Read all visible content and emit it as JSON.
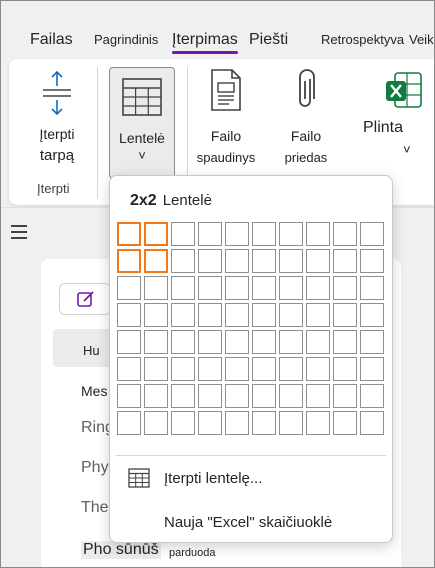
{
  "tabs": [
    {
      "label": "Failas"
    },
    {
      "label": "Pagrindinis"
    },
    {
      "label": "Įterpimas"
    },
    {
      "label": "Piešti"
    },
    {
      "label": "Retrospektyva"
    },
    {
      "label": "Veiks"
    }
  ],
  "ribbon": {
    "insert_space": {
      "line1": "Įterpti",
      "line2": "tarpą"
    },
    "group_label": "Įterpti",
    "table": {
      "label": "Lentelė",
      "chevron": "˅"
    },
    "file_printout": {
      "line1": "Failo",
      "line2": "spaudinys"
    },
    "file_attachment": {
      "line1": "Failo",
      "line2": "priedas"
    },
    "spreadsheet": {
      "label": "Plinta",
      "chevron": "˅"
    }
  },
  "page_list": {
    "items": [
      {
        "label": "Hu"
      },
      {
        "label": "Mes"
      },
      {
        "label": "Ring"
      },
      {
        "label": "Phy"
      },
      {
        "label": "The"
      },
      {
        "label": "Pho sūnūš"
      }
    ],
    "extra_label": "parduoda"
  },
  "table_dropdown": {
    "size_label": "2x2",
    "title": "Lentelė",
    "grid": {
      "columns": 10,
      "rows": 8,
      "selected_columns": 2,
      "selected_rows": 2
    },
    "insert_table_label": "Įterpti lentelę...",
    "new_excel_label": "Nauja \"Excel\" skaičiuoklė"
  },
  "colors": {
    "accent": "#7719aa",
    "selection": "#f07a1a",
    "excel_green": "#107c41"
  },
  "icons": [
    "insert-space-icon",
    "table-icon",
    "file-printout-icon",
    "paperclip-icon",
    "excel-icon",
    "hamburger-icon",
    "edit-icon",
    "chevron-down-icon"
  ]
}
